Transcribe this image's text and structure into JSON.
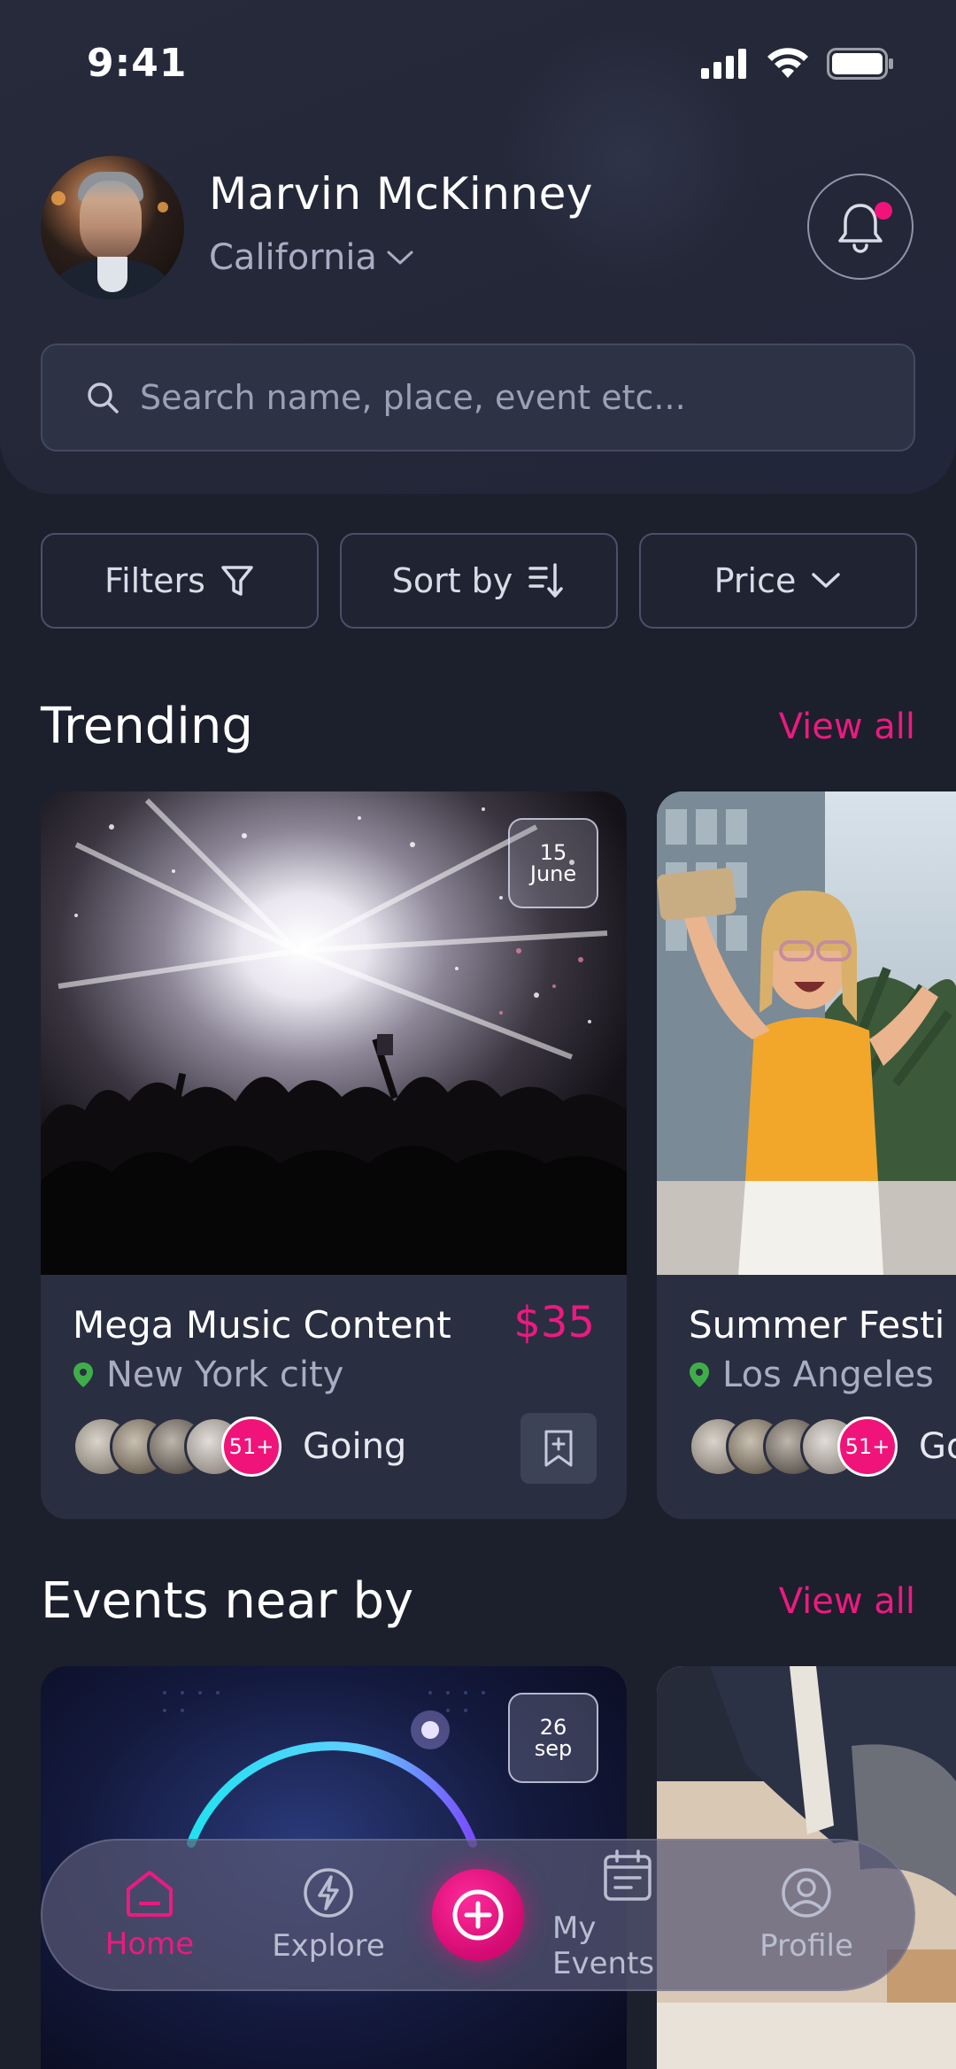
{
  "status_bar": {
    "time": "9:41"
  },
  "user": {
    "name": "Marvin McKinney",
    "location": "California"
  },
  "search": {
    "placeholder": "Search name, place, event etc..."
  },
  "filters": [
    {
      "label": "Filters",
      "icon": "funnel-icon"
    },
    {
      "label": "Sort by",
      "icon": "sort-icon"
    },
    {
      "label": "Price",
      "icon": "chevron-down-icon"
    }
  ],
  "trending": {
    "title": "Trending",
    "view_all": "View all",
    "cards": [
      {
        "title": "Mega Music Content",
        "price": "$35",
        "location": "New York city",
        "date_day": "15",
        "date_month": "June",
        "going_count": "51+",
        "going_label": "Going"
      },
      {
        "title": "Summer Festi",
        "price": "",
        "location": "Los Angeles",
        "going_count": "51+",
        "going_label": "Goi"
      }
    ]
  },
  "nearby": {
    "title": "Events near by",
    "view_all": "View all",
    "cards": [
      {
        "date_day": "26",
        "date_month": "sep"
      }
    ]
  },
  "nav": {
    "items": [
      {
        "label": "Home",
        "icon": "home-icon",
        "active": true
      },
      {
        "label": "Explore",
        "icon": "lightning-icon"
      },
      {
        "label": "",
        "icon": "plus-icon"
      },
      {
        "label": "My Events",
        "icon": "calendar-icon"
      },
      {
        "label": "Profile",
        "icon": "user-icon"
      }
    ]
  },
  "colors": {
    "accent": "#ec1a80",
    "background": "#1c1f2c",
    "card": "#2a2e41",
    "location_pin": "#3fae49"
  }
}
